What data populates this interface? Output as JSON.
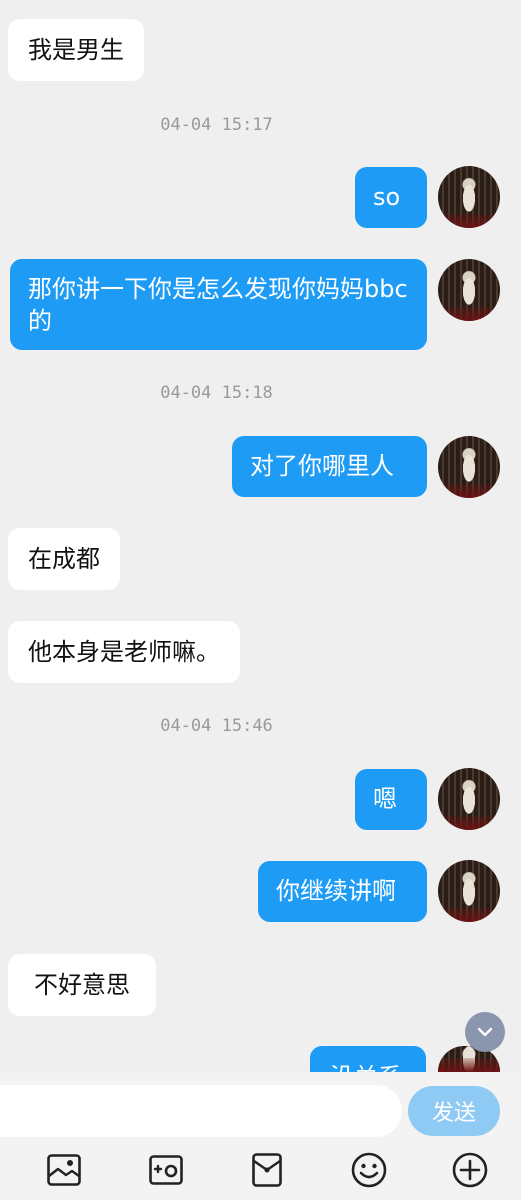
{
  "messages": [
    {
      "side": "in",
      "text": "我是男生"
    },
    {
      "timestamp": "04-04 15:17"
    },
    {
      "side": "out",
      "text": "so"
    },
    {
      "side": "out",
      "text": "那你讲一下你是怎么发现你妈妈bbc的"
    },
    {
      "timestamp": "04-04 15:18"
    },
    {
      "side": "out",
      "text": "对了你哪里人"
    },
    {
      "side": "in",
      "text": "在成都"
    },
    {
      "side": "in",
      "text": "他本身是老师嘛。"
    },
    {
      "timestamp": "04-04 15:46"
    },
    {
      "side": "out",
      "text": "嗯"
    },
    {
      "side": "out",
      "text": "你继续讲啊"
    },
    {
      "side": "in",
      "text": "不好意思"
    },
    {
      "side": "out",
      "text": "没关系",
      "clipped": true
    }
  ],
  "input": {
    "value": "",
    "placeholder": ""
  },
  "send_label": "发送",
  "toolbar": {
    "icons": [
      "image-icon",
      "camera-icon",
      "red-packet-icon",
      "emoji-icon",
      "plus-icon"
    ]
  },
  "colors": {
    "outgoing_bubble": "#1e9bf5",
    "incoming_bubble": "#ffffff",
    "background": "#efefef",
    "send_button": "#8fcaf4"
  }
}
